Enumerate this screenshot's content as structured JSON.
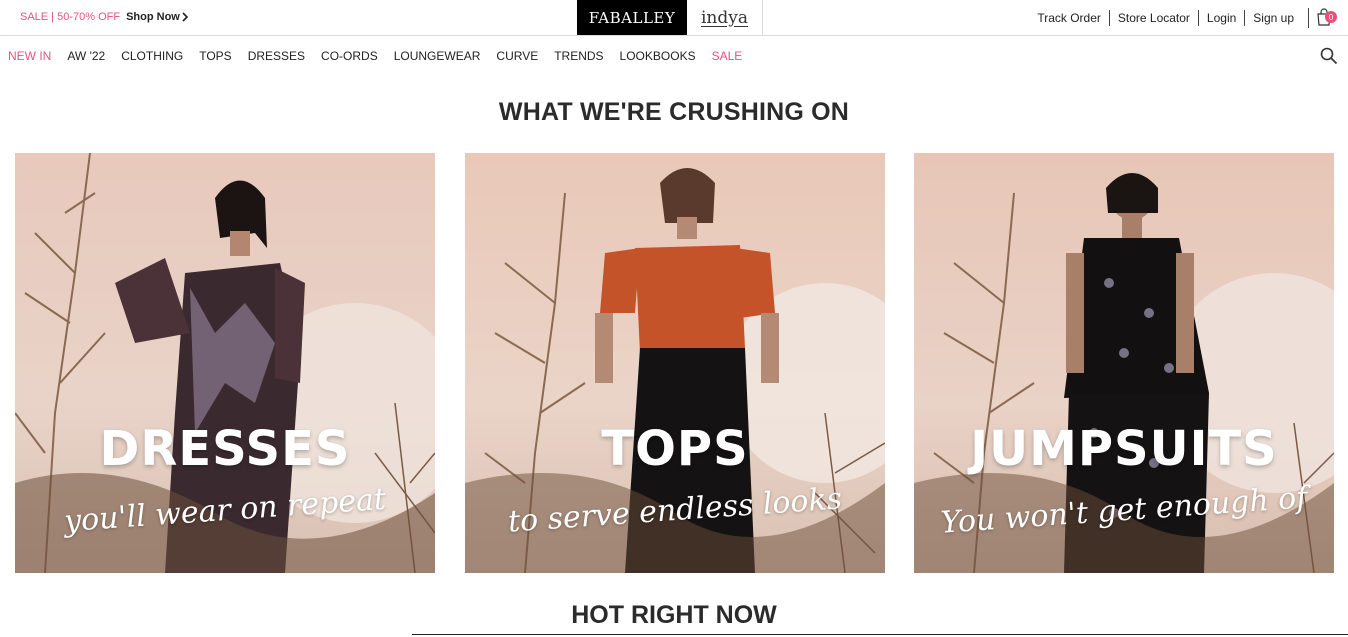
{
  "topbar": {
    "promo_sale": "SALE | 50-70% OFF",
    "promo_shop": "Shop Now",
    "brand_primary": "FABALLEY",
    "brand_secondary": "indya",
    "links": [
      "Track Order",
      "Store Locator",
      "Login",
      "Sign up"
    ],
    "cart_count": "0"
  },
  "nav": {
    "items": [
      {
        "label": "NEW IN",
        "accent": true
      },
      {
        "label": "AW '22",
        "accent": false
      },
      {
        "label": "CLOTHING",
        "accent": false
      },
      {
        "label": "TOPS",
        "accent": false
      },
      {
        "label": "DRESSES",
        "accent": false
      },
      {
        "label": "CO-ORDS",
        "accent": false
      },
      {
        "label": "LOUNGEWEAR",
        "accent": false
      },
      {
        "label": "CURVE",
        "accent": false
      },
      {
        "label": "TRENDS",
        "accent": false
      },
      {
        "label": "LOOKBOOKS",
        "accent": false
      },
      {
        "label": "SALE",
        "accent": true
      }
    ]
  },
  "section": {
    "title": "WHAT WE'RE CRUSHING ON",
    "cards": [
      {
        "title": "DRESSES",
        "tagline": "you'll wear on repeat"
      },
      {
        "title": "TOPS",
        "tagline": "to serve endless looks"
      },
      {
        "title": "JUMPSUITS",
        "tagline": "You won't get enough of"
      }
    ]
  },
  "section2": {
    "title": "HOT RIGHT NOW"
  },
  "colors": {
    "accent": "#e8527a",
    "brand_bg": "#000000"
  }
}
